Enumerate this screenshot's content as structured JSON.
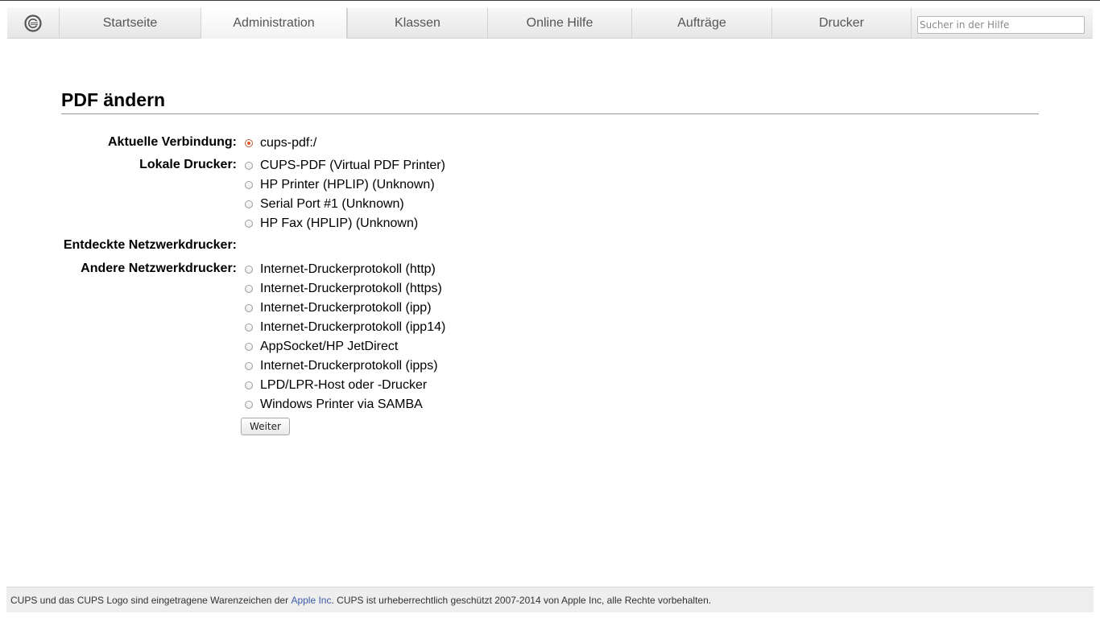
{
  "nav": {
    "logo_icon": "cups-logo-icon",
    "tabs": [
      {
        "label": "Startseite",
        "active": false
      },
      {
        "label": "Administration",
        "active": true
      },
      {
        "label": "Klassen",
        "active": false
      },
      {
        "label": "Online Hilfe",
        "active": false
      },
      {
        "label": "Aufträge",
        "active": false
      },
      {
        "label": "Drucker",
        "active": false
      }
    ],
    "search_placeholder": "Sucher in der Hilfe",
    "search_value": ""
  },
  "main": {
    "title": "PDF ändern",
    "current_connection": {
      "label": "Aktuelle Verbindung:",
      "option": "cups-pdf:/",
      "selected": true
    },
    "local_printers": {
      "label": "Lokale Drucker:",
      "options": [
        "CUPS-PDF (Virtual PDF Printer)",
        "HP Printer (HPLIP) (Unknown)",
        "Serial Port #1 (Unknown)",
        "HP Fax (HPLIP) (Unknown)"
      ]
    },
    "discovered_network_printers": {
      "label": "Entdeckte Netzwerkdrucker:",
      "options": []
    },
    "other_network_printers": {
      "label": "Andere Netzwerkdrucker:",
      "options": [
        "Internet-Druckerprotokoll (http)",
        "Internet-Druckerprotokoll (https)",
        "Internet-Druckerprotokoll (ipp)",
        "Internet-Druckerprotokoll (ipp14)",
        "AppSocket/HP JetDirect",
        "Internet-Druckerprotokoll (ipps)",
        "LPD/LPR-Host oder -Drucker",
        "Windows Printer via SAMBA"
      ]
    },
    "continue_label": "Weiter"
  },
  "footer": {
    "text_before": "CUPS und das CUPS Logo sind eingetragene Warenzeichen der ",
    "link": "Apple Inc",
    "text_after": ". CUPS ist urheberrechtlich geschützt 2007-2014 von Apple Inc, alle Rechte vorbehalten."
  },
  "colors": {
    "radio_selected": "#e0562a",
    "footer_link": "#3b5aa6",
    "footer_bg": "#eeeeee"
  }
}
